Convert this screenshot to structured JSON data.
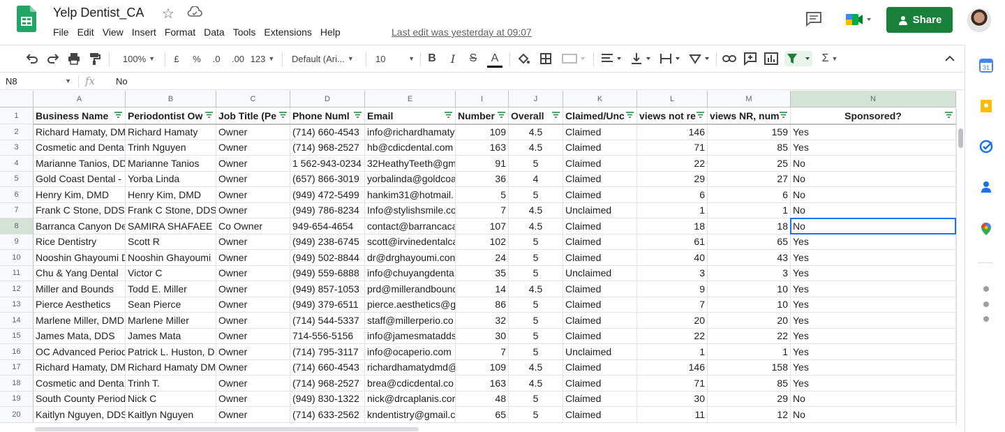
{
  "title": "Yelp Dentist_CA",
  "menu": [
    "File",
    "Edit",
    "View",
    "Insert",
    "Format",
    "Data",
    "Tools",
    "Extensions",
    "Help"
  ],
  "last_edit": "Last edit was yesterday at 09:07",
  "share_label": "Share",
  "toolbar": {
    "zoom": "100%",
    "currency": "£",
    "percent": "%",
    "dec_decrease": ".0",
    "dec_increase": ".00",
    "format_more": "123",
    "font": "Default (Ari...",
    "font_size": "10",
    "bold": "B",
    "italic": "I",
    "strike": "S",
    "text_color": "A",
    "sum": "Σ"
  },
  "name_box": "N8",
  "fx_label": "fx",
  "formula_value": "No",
  "columns": [
    {
      "letter": "A",
      "header": "Business Name"
    },
    {
      "letter": "B",
      "header": "Periodontist Ow"
    },
    {
      "letter": "C",
      "header": "Job Title (Pe"
    },
    {
      "letter": "D",
      "header": "Phone Numl"
    },
    {
      "letter": "E",
      "header": "Email"
    },
    {
      "letter": "I",
      "header": "Number"
    },
    {
      "letter": "J",
      "header": "Overall"
    },
    {
      "letter": "K",
      "header": "Claimed/Unc"
    },
    {
      "letter": "L",
      "header": "views not re"
    },
    {
      "letter": "M",
      "header": "views NR, num"
    },
    {
      "letter": "N",
      "header": "Sponsored?"
    }
  ],
  "row_numbers": [
    "1",
    "2",
    "3",
    "4",
    "5",
    "6",
    "7",
    "8",
    "9",
    "10",
    "11",
    "12",
    "13",
    "14",
    "15",
    "16",
    "17",
    "18",
    "19",
    "20"
  ],
  "rows": [
    [
      "Richard Hamaty, DM",
      "Richard Hamaty",
      "Owner",
      "(714) 660-4543",
      "info@richardhamaty",
      "109",
      "4.5",
      "Claimed",
      "146",
      "159",
      "Yes"
    ],
    [
      "Cosmetic and Denta",
      "Trinh Nguyen",
      "Owner",
      "(714) 968-2527",
      "hb@cdicdental.com",
      "163",
      "4.5",
      "Claimed",
      "71",
      "85",
      "Yes"
    ],
    [
      "Marianne Tanios, DD",
      "Marianne Tanios",
      "Owner",
      "1 562-943-0234",
      "32HeathyTeeth@gm",
      "91",
      "5",
      "Claimed",
      "22",
      "25",
      "No"
    ],
    [
      "Gold Coast Dental -",
      "Yorba Linda",
      "Owner",
      "(657) 866-3019",
      "yorbalinda@goldcoa",
      "36",
      "4",
      "Claimed",
      "29",
      "27",
      "No"
    ],
    [
      "Henry Kim, DMD",
      "Henry Kim, DMD",
      "Owner",
      "(949) 472-5499",
      "hankim31@hotmail.",
      "5",
      "5",
      "Claimed",
      "6",
      "6",
      "No"
    ],
    [
      "Frank C Stone, DDS",
      "Frank C Stone, DDS",
      "Owner",
      "(949) 786-8234",
      "Info@stylishsmile.co",
      "7",
      "4.5",
      "Unclaimed",
      "1",
      "1",
      "No"
    ],
    [
      "Barranca Canyon De",
      "SAMIRA SHAFAEE",
      "Co Owner",
      "949-654-4654",
      "contact@barrancaca",
      "107",
      "4.5",
      "Claimed",
      "18",
      "18",
      "No"
    ],
    [
      "Rice Dentistry",
      "Scott R",
      "Owner",
      "(949) 238-6745",
      "scott@irvinedentalca",
      "102",
      "5",
      "Claimed",
      "61",
      "65",
      "Yes"
    ],
    [
      "Nooshin Ghayoumi D",
      "Nooshin Ghayoumi",
      "Owner",
      "(949) 502-8844",
      "dr@drghayoumi.con",
      "24",
      "5",
      "Claimed",
      "40",
      "43",
      "Yes"
    ],
    [
      "Chu & Yang Dental",
      "Victor C",
      "Owner",
      "(949) 559-6888",
      "info@chuyangdenta",
      "35",
      "5",
      "Unclaimed",
      "3",
      "3",
      "Yes"
    ],
    [
      "Miller and Bounds",
      "Todd E. Miller",
      "Owner",
      "(949) 857-1053",
      "prd@millerandbounc",
      "14",
      "4.5",
      "Claimed",
      "9",
      "10",
      "Yes"
    ],
    [
      "Pierce Aesthetics",
      "Sean Pierce",
      "Owner",
      "(949) 379-6511",
      "pierce.aesthetics@g",
      "86",
      "5",
      "Claimed",
      "7",
      "10",
      "Yes"
    ],
    [
      "Marlene Miller, DMD",
      "Marlene Miller",
      "Owner",
      "(714) 544-5337",
      "staff@millerperio.co",
      "32",
      "5",
      "Claimed",
      "20",
      "20",
      "Yes"
    ],
    [
      "James Mata, DDS",
      "James Mata",
      "Owner",
      "714-556-5156",
      "info@jamesmatadds",
      "30",
      "5",
      "Claimed",
      "22",
      "22",
      "Yes"
    ],
    [
      "OC Advanced Period",
      "Patrick L. Huston, D",
      "Owner",
      "(714) 795-3117",
      "info@ocaperio.com",
      "7",
      "5",
      "Unclaimed",
      "1",
      "1",
      "Yes"
    ],
    [
      "Richard Hamaty, DM",
      "Richard Hamaty DM",
      "Owner",
      "(714) 660-4543",
      "richardhamatydmd@",
      "109",
      "4.5",
      "Claimed",
      "146",
      "158",
      "Yes"
    ],
    [
      "Cosmetic and Denta",
      "Trinh T.",
      "Owner",
      "(714) 968-2527",
      "brea@cdicdental.co",
      "163",
      "4.5",
      "Claimed",
      "71",
      "85",
      "Yes"
    ],
    [
      "South County Period",
      "Nick C",
      "Owner",
      "(949) 830-1322",
      "nick@drcaplanis.cor",
      "48",
      "5",
      "Claimed",
      "30",
      "29",
      "No"
    ],
    [
      "Kaitlyn Nguyen, DDS",
      "Kaitlyn Nguyen",
      "Owner",
      "(714) 633-2562",
      "kndentistry@gmail.c",
      "65",
      "5",
      "Claimed",
      "11",
      "12",
      "No"
    ]
  ],
  "colors": {
    "accent": "#188038",
    "selection": "#1a73e8",
    "header_sel": "#d3e3d6"
  }
}
